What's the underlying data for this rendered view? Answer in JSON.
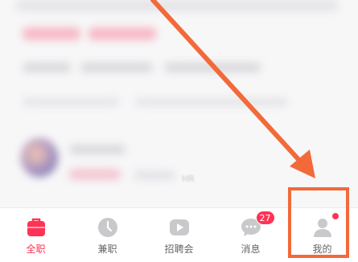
{
  "tabbar": {
    "items": [
      {
        "label": "全职",
        "icon": "briefcase-icon",
        "active": true
      },
      {
        "label": "兼职",
        "icon": "clock-icon",
        "active": false
      },
      {
        "label": "招聘会",
        "icon": "play-icon",
        "active": false
      },
      {
        "label": "消息",
        "icon": "chat-icon",
        "active": false,
        "badge": "27"
      },
      {
        "label": "我的",
        "icon": "user-icon",
        "active": false,
        "dot": true
      }
    ]
  },
  "blurred_text": "HR",
  "colors": {
    "accent": "#ff3355",
    "icon_gray": "#c9c9cc",
    "annotation": "#f26a3a"
  }
}
